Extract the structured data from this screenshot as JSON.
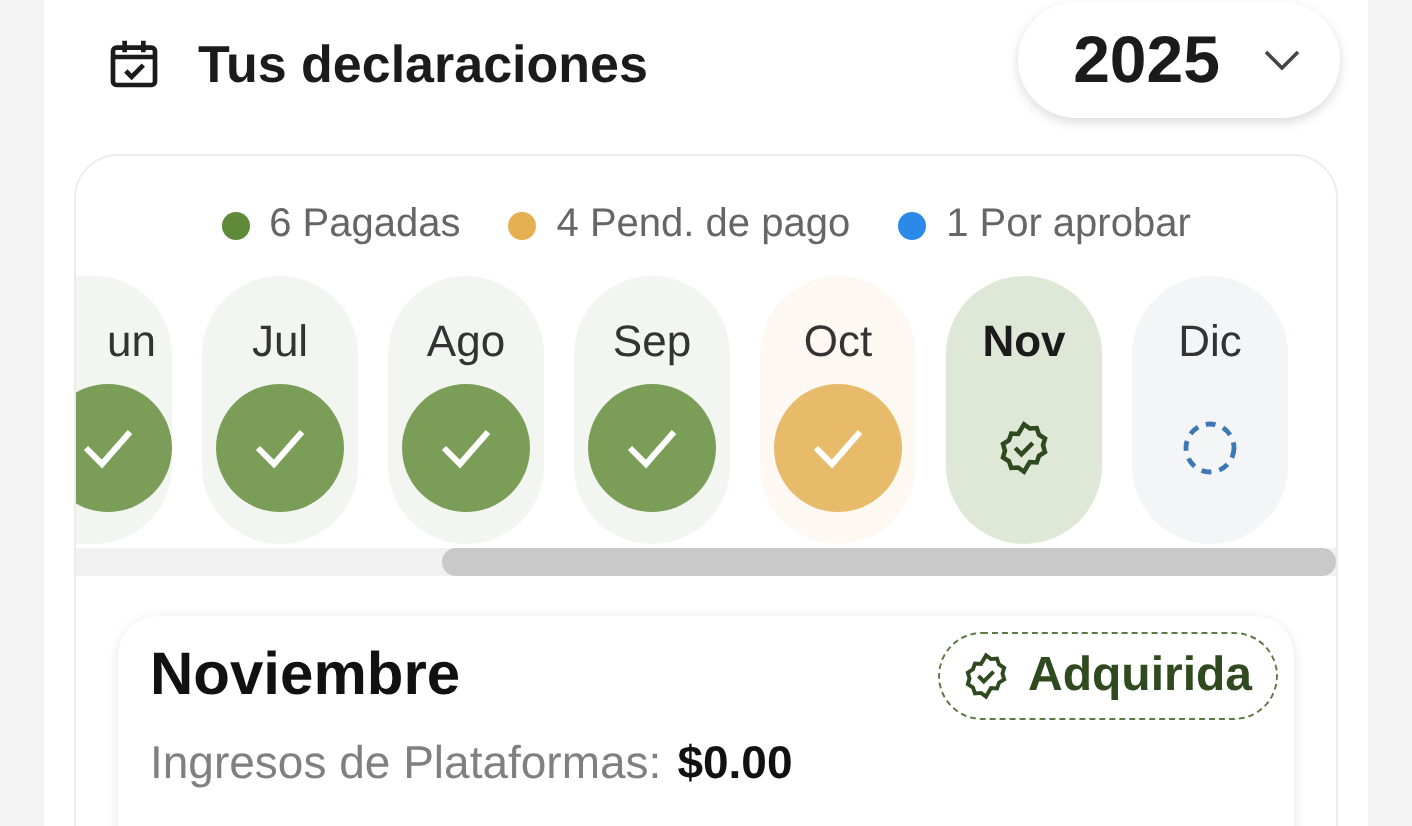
{
  "header": {
    "title": "Tus declaraciones",
    "year": "2025"
  },
  "legend": [
    {
      "label": "6 Pagadas",
      "color": "#5e8a3a"
    },
    {
      "label": "4 Pend. de pago",
      "color": "#e5b04f"
    },
    {
      "label": "1 Por aprobar",
      "color": "#2b8ae8"
    }
  ],
  "months": [
    {
      "label": "un",
      "kind": "paid",
      "selected": false
    },
    {
      "label": "Jul",
      "kind": "paid",
      "selected": false
    },
    {
      "label": "Ago",
      "kind": "paid",
      "selected": false
    },
    {
      "label": "Sep",
      "kind": "paid",
      "selected": false
    },
    {
      "label": "Oct",
      "kind": "pending",
      "selected": false
    },
    {
      "label": "Nov",
      "kind": "acquired",
      "selected": true
    },
    {
      "label": "Dic",
      "kind": "upcoming",
      "selected": false
    }
  ],
  "detail": {
    "title": "Noviembre",
    "status": "Adquirida",
    "income_label": "Ingresos de Plataformas:",
    "income_value": "$0.00"
  }
}
